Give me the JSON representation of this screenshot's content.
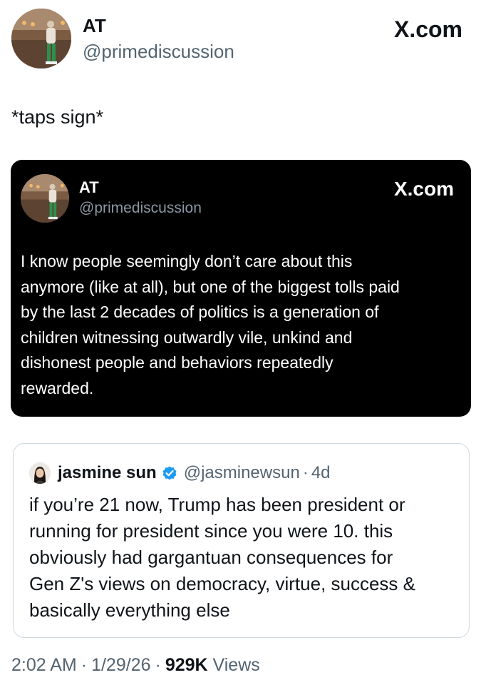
{
  "author": {
    "name": "AT",
    "handle": "@primediscussion"
  },
  "brand": "X.com",
  "tweet": {
    "text": "*taps sign*"
  },
  "embedded_post": {
    "name": "AT",
    "handle": "@primediscussion",
    "brand": "X.com",
    "lines": [
      "I know people seemingly don’t care about this",
      "anymore (like at all), but one of the biggest tolls paid",
      "by the last 2 decades of politics is a generation of",
      "children witnessing outwardly vile, unkind and",
      "dishonest people and behaviors repeatedly",
      "rewarded."
    ]
  },
  "quoted_tweet": {
    "name": "jasmine sun",
    "verified_icon": "verified-badge-icon",
    "handle": "@jasminewsun",
    "separator": "·",
    "time": "4d",
    "lines": [
      "if you’re 21 now, Trump has been president or",
      "running for president since you were 10. this",
      "obviously had gargantuan consequences for",
      "Gen Z's views on democracy, virtue, success &",
      "basically everything else"
    ]
  },
  "meta": {
    "time": "2:02 AM",
    "separator": "·",
    "date": "1/29/26",
    "views_count": "929K",
    "views_label": "Views"
  },
  "colors": {
    "text": "#0f1419",
    "secondary": "#536471",
    "verified": "#1d9bf0",
    "card_dark": "#000000",
    "border": "#cfd9de"
  }
}
